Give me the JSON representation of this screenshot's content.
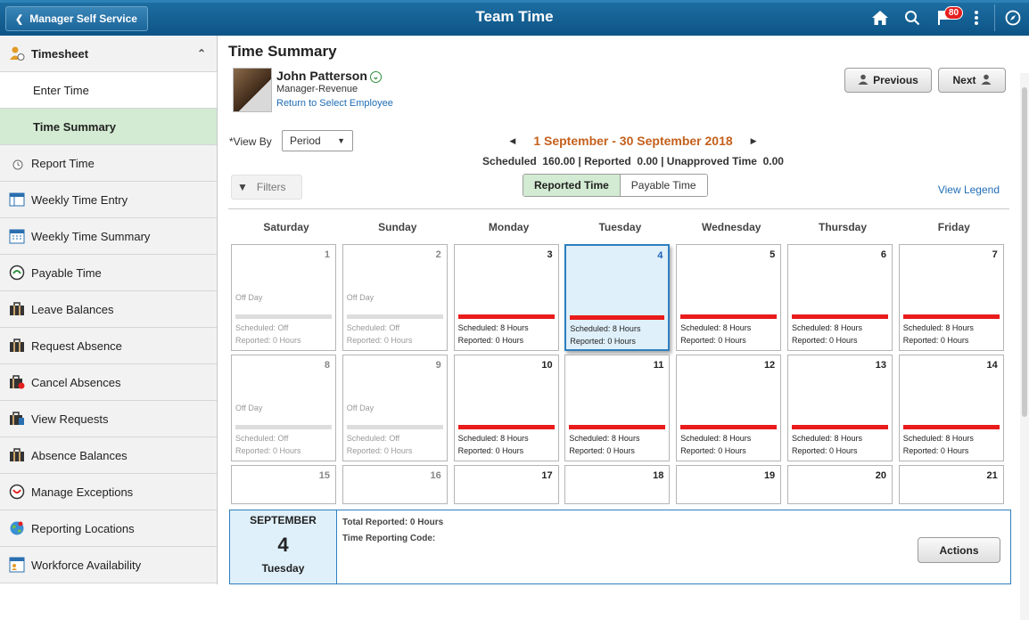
{
  "header": {
    "back_label": "Manager Self Service",
    "title": "Team Time",
    "notification_count": "80"
  },
  "sidebar": {
    "items": [
      {
        "label": "Timesheet",
        "icon": "timesheet-icon"
      },
      {
        "label": "Enter Time"
      },
      {
        "label": "Time Summary"
      },
      {
        "label": "Report Time",
        "icon": "clock-icon"
      },
      {
        "label": "Weekly Time Entry",
        "icon": "grid-icon"
      },
      {
        "label": "Weekly Time Summary",
        "icon": "calendar-icon"
      },
      {
        "label": "Payable Time",
        "icon": "money-clock-icon"
      },
      {
        "label": "Leave Balances",
        "icon": "briefcase-icon"
      },
      {
        "label": "Request Absence",
        "icon": "briefcase-icon"
      },
      {
        "label": "Cancel Absences",
        "icon": "briefcase-cancel-icon"
      },
      {
        "label": "View Requests",
        "icon": "briefcase-view-icon"
      },
      {
        "label": "Absence Balances",
        "icon": "briefcase-icon"
      },
      {
        "label": "Manage Exceptions",
        "icon": "exception-icon"
      },
      {
        "label": "Reporting Locations",
        "icon": "globe-icon"
      },
      {
        "label": "Workforce Availability",
        "icon": "availability-icon"
      }
    ]
  },
  "main": {
    "title": "Time Summary",
    "employee": {
      "name": "John Patterson",
      "role": "Manager-Revenue",
      "link": "Return to Select Employee"
    },
    "previous_label": "Previous",
    "next_label": "Next",
    "view_by_label": "*View By",
    "view_by_value": "Period",
    "period": "1 September - 30 September 2018",
    "totals": "Scheduled  160.00 | Reported  0.00 | Unapproved Time  0.00",
    "filters_label": "Filters",
    "toggle": [
      "Reported Time",
      "Payable Time"
    ],
    "legend_link": "View Legend",
    "weekdays": [
      "Saturday",
      "Sunday",
      "Monday",
      "Tuesday",
      "Wednesday",
      "Thursday",
      "Friday"
    ],
    "weeks": [
      [
        {
          "day": "1",
          "off": true,
          "offday": "Off Day",
          "scheduled": "Scheduled: Off",
          "reported": "Reported: 0 Hours"
        },
        {
          "day": "2",
          "off": true,
          "offday": "Off Day",
          "scheduled": "Scheduled: Off",
          "reported": "Reported: 0 Hours"
        },
        {
          "day": "3",
          "scheduled": "Scheduled: 8 Hours",
          "reported": "Reported: 0 Hours"
        },
        {
          "day": "4",
          "selected": true,
          "scheduled": "Scheduled: 8 Hours",
          "reported": "Reported: 0 Hours"
        },
        {
          "day": "5",
          "scheduled": "Scheduled: 8 Hours",
          "reported": "Reported: 0 Hours"
        },
        {
          "day": "6",
          "scheduled": "Scheduled: 8 Hours",
          "reported": "Reported: 0 Hours"
        },
        {
          "day": "7",
          "scheduled": "Scheduled: 8 Hours",
          "reported": "Reported: 0 Hours"
        }
      ],
      [
        {
          "day": "8",
          "off": true,
          "offday": "Off Day",
          "scheduled": "Scheduled: Off",
          "reported": "Reported: 0 Hours"
        },
        {
          "day": "9",
          "off": true,
          "offday": "Off Day",
          "scheduled": "Scheduled: Off",
          "reported": "Reported: 0 Hours"
        },
        {
          "day": "10",
          "scheduled": "Scheduled: 8 Hours",
          "reported": "Reported: 0 Hours"
        },
        {
          "day": "11",
          "scheduled": "Scheduled: 8 Hours",
          "reported": "Reported: 0 Hours"
        },
        {
          "day": "12",
          "scheduled": "Scheduled: 8 Hours",
          "reported": "Reported: 0 Hours"
        },
        {
          "day": "13",
          "scheduled": "Scheduled: 8 Hours",
          "reported": "Reported: 0 Hours"
        },
        {
          "day": "14",
          "scheduled": "Scheduled: 8 Hours",
          "reported": "Reported: 0 Hours"
        }
      ],
      [
        {
          "day": "15",
          "off": true
        },
        {
          "day": "16",
          "off": true
        },
        {
          "day": "17"
        },
        {
          "day": "18"
        },
        {
          "day": "19"
        },
        {
          "day": "20"
        },
        {
          "day": "21"
        }
      ]
    ],
    "detail": {
      "month": "SEPTEMBER",
      "day": "4",
      "weekday": "Tuesday",
      "total_reported": "Total Reported:  0 Hours",
      "trc": "Time Reporting Code:",
      "actions_label": "Actions"
    }
  },
  "colors": {
    "header": "#0d5486",
    "active_green": "#d2ebd2",
    "period_orange": "#c5601c",
    "bar_red": "#e91b1b"
  }
}
